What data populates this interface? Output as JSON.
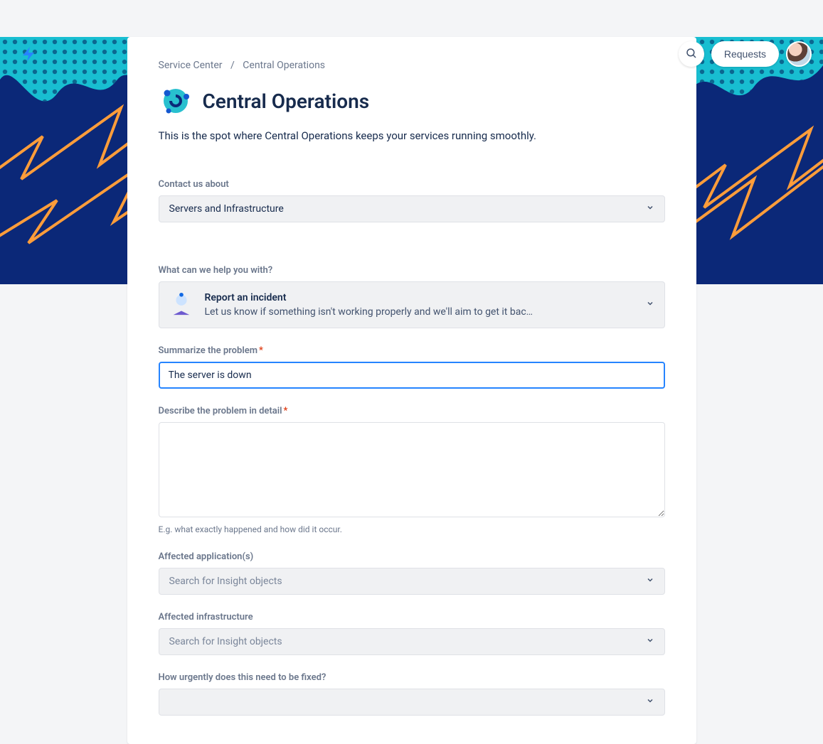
{
  "header": {
    "requests_label": "Requests"
  },
  "breadcrumb": {
    "root": "Service Center",
    "current": "Central Operations"
  },
  "page": {
    "title": "Central Operations",
    "description": "This is the spot where Central Operations keeps your services running smoothly."
  },
  "form": {
    "contact_label": "Contact us about",
    "contact_value": "Servers and Infrastructure",
    "help_label": "What can we help you with?",
    "request_type": {
      "title": "Report an incident",
      "desc": "Let us know if something isn't working properly and we'll aim to get it bac…"
    },
    "summary_label": "Summarize the problem",
    "summary_value": "The server is down",
    "detail_label": "Describe the problem in detail",
    "detail_hint": "E.g. what exactly happened and how did it occur.",
    "affected_apps_label": "Affected application(s)",
    "affected_apps_placeholder": "Search for Insight objects",
    "affected_infra_label": "Affected infrastructure",
    "affected_infra_placeholder": "Search for Insight objects",
    "urgency_label": "How urgently does this need to be fixed?"
  }
}
